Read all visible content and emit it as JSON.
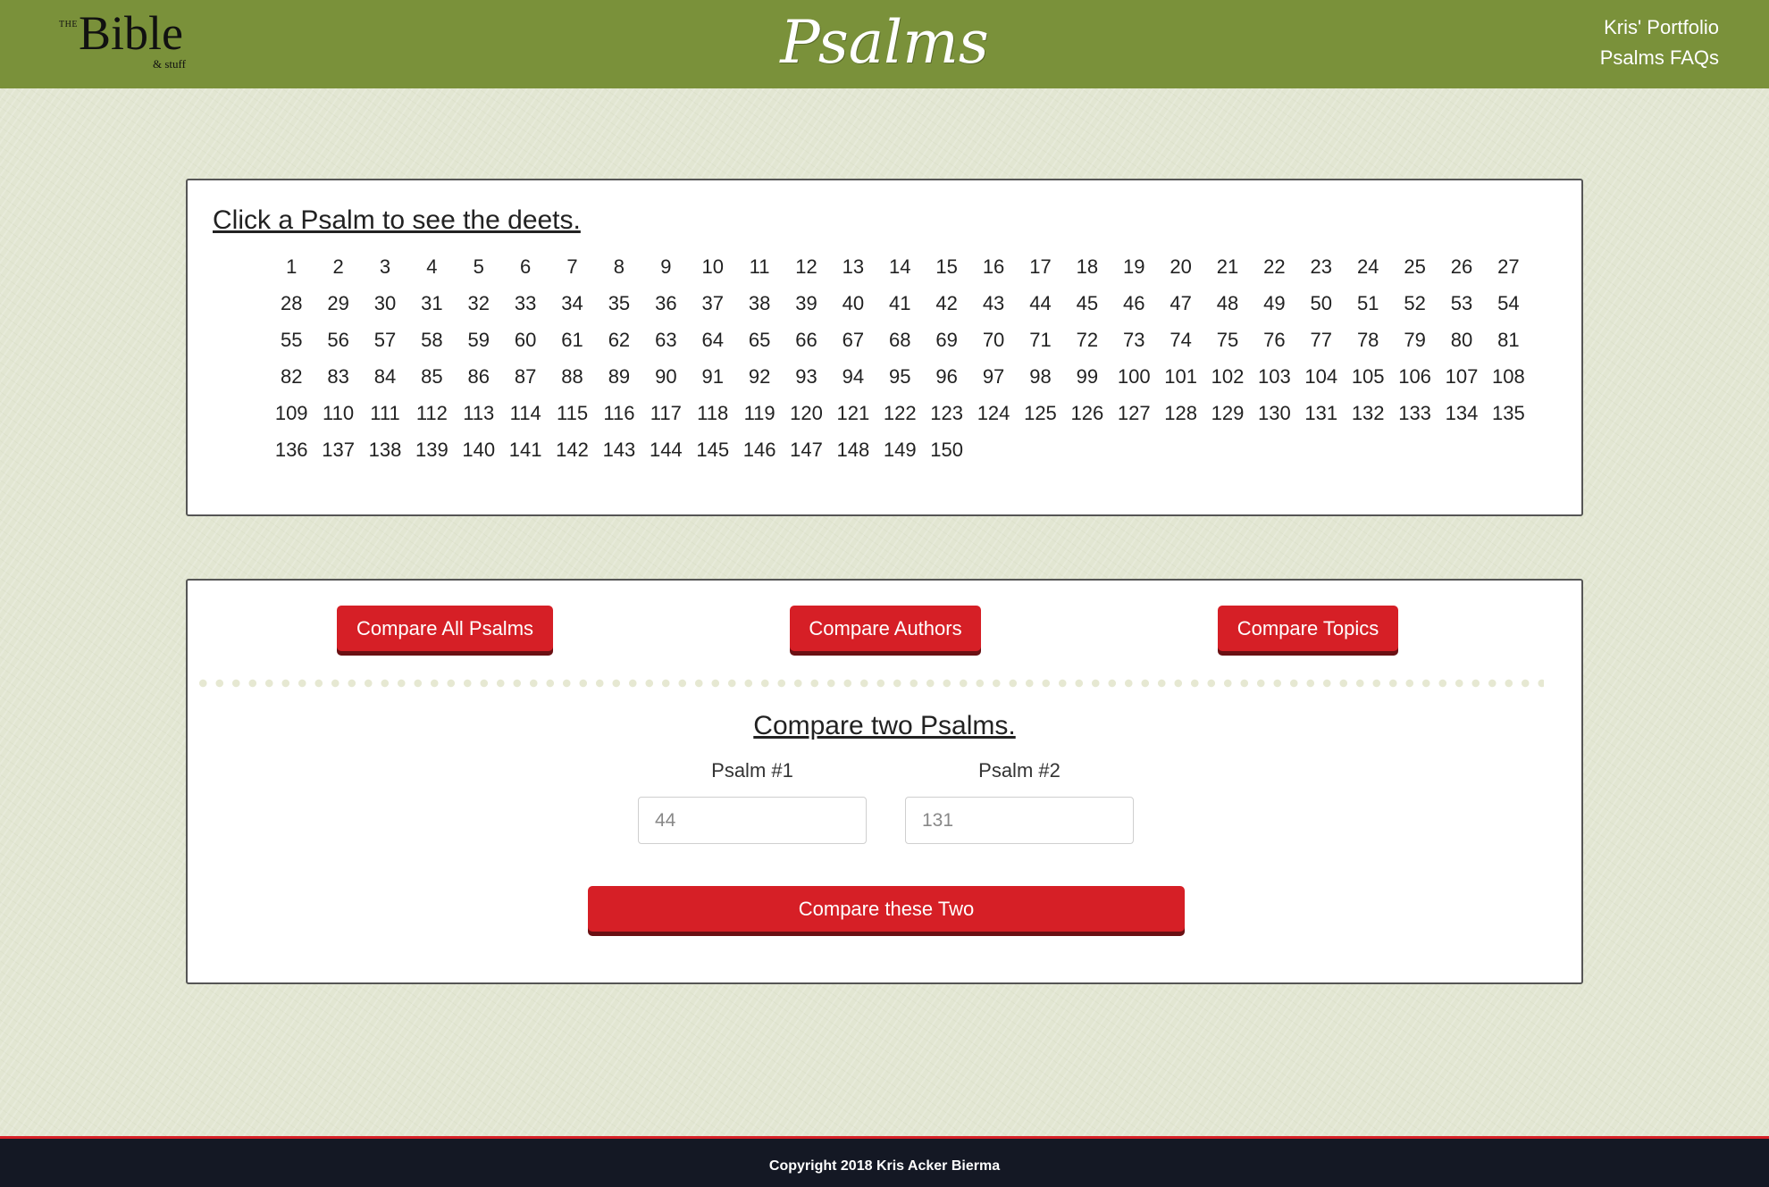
{
  "header": {
    "logo": {
      "the": "THE",
      "bible": "Bible",
      "stuff": "& stuff"
    },
    "title": "Psalms",
    "nav": [
      "Kris' Portfolio",
      "Psalms FAQs"
    ]
  },
  "psalm_list": {
    "heading": "Click a Psalm to see the deets.",
    "count": 150
  },
  "compare": {
    "buttons": [
      "Compare All Psalms",
      "Compare Authors",
      "Compare Topics"
    ],
    "two_heading": "Compare two Psalms.",
    "psalm1": {
      "label": "Psalm #1",
      "placeholder": "44"
    },
    "psalm2": {
      "label": "Psalm #2",
      "placeholder": "131"
    },
    "submit_label": "Compare these Two"
  },
  "footer": {
    "copyright": "Copyright 2018 Kris Acker Bierma"
  },
  "colors": {
    "header_green": "#7a913a",
    "button_red": "#d61f26",
    "footer_navy": "#141824",
    "page_background": "#e2e6d2"
  }
}
